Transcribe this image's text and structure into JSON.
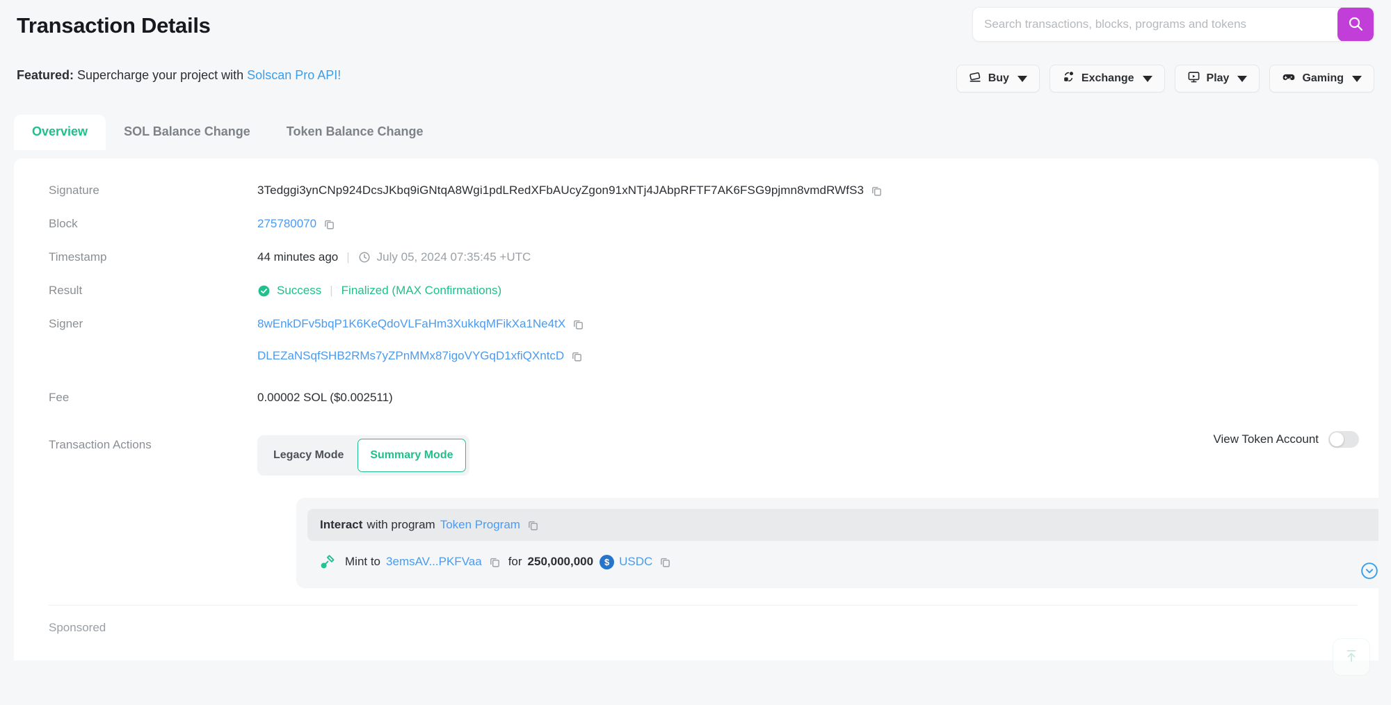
{
  "header": {
    "title": "Transaction Details",
    "featured_label": "Featured:",
    "featured_text": "Supercharge your project with",
    "featured_link": "Solscan Pro API!"
  },
  "search": {
    "placeholder": "Search transactions, blocks, programs and tokens",
    "value": "",
    "button_icon": "search-icon",
    "button_color": "#c13ed8"
  },
  "topnav": {
    "items": [
      {
        "label": "Buy",
        "icon": "card-swipe-icon"
      },
      {
        "label": "Exchange",
        "icon": "exchange-icon"
      },
      {
        "label": "Play",
        "icon": "play-monitor-icon"
      },
      {
        "label": "Gaming",
        "icon": "gamepad-icon"
      }
    ]
  },
  "tabs": [
    {
      "label": "Overview",
      "active": true
    },
    {
      "label": "SOL Balance Change",
      "active": false
    },
    {
      "label": "Token Balance Change",
      "active": false
    }
  ],
  "details": {
    "signature": {
      "label": "Signature",
      "value": "3Tedggi3ynCNp924DcsJKbq9iGNtqA8Wgi1pdLRedXFbAUcyZgon91xNTj4JAbpRFTF7AK6FSG9pjmn8vmdRWfS3"
    },
    "block": {
      "label": "Block",
      "value": "275780070"
    },
    "timestamp": {
      "label": "Timestamp",
      "relative": "44 minutes ago",
      "absolute": "July 05, 2024 07:35:45 +UTC"
    },
    "result": {
      "label": "Result",
      "status": "Success",
      "confirmation": "Finalized (MAX Confirmations)"
    },
    "signer": {
      "label": "Signer",
      "values": [
        "8wEnkDFv5bqP1K6KeQdoVLFaHm3XukkqMFikXa1Ne4tX",
        "DLEZaNSqfSHB2RMs7yZPnMMx87igoVYGqD1xfiQXntcD"
      ]
    },
    "fee": {
      "label": "Fee",
      "value": "0.00002 SOL ($0.002511)"
    },
    "transaction_actions": {
      "label": "Transaction Actions",
      "modes": [
        {
          "label": "Legacy Mode",
          "active": false
        },
        {
          "label": "Summary Mode",
          "active": true
        }
      ],
      "token_account_toggle": {
        "label": "View Token Account",
        "on": false
      },
      "interact": {
        "prefix": "Interact",
        "middle": "with program",
        "program": "Token Program"
      },
      "mint": {
        "icon": "mint-hammer-icon",
        "action": "Mint to",
        "destination": "3emsAV...PKFVaa",
        "for_label": "for",
        "amount": "250,000,000",
        "token": "USDC",
        "token_badge": "$",
        "expand_icon": "chevron-down-circle-icon"
      }
    }
  },
  "footer": {
    "sponsored_label": "Sponsored"
  },
  "scroll_top": {
    "icon": "scroll-to-top-icon"
  },
  "colors": {
    "accent_green": "#1fc08d",
    "link_blue": "#4a9bf0",
    "search_purple": "#c13ed8",
    "usdc_blue": "#2775ca"
  }
}
